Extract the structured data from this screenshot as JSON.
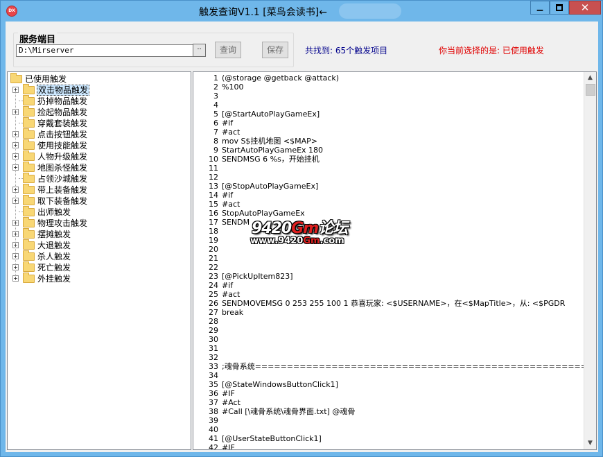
{
  "window": {
    "icon_text": "DX",
    "title": "触发查询V1.1 [菜鸟会读书]←",
    "min_glyph": "▁",
    "close_glyph": "✕"
  },
  "toolbar": {
    "group_title": "服务端目",
    "path_value": "D:\\Mirserver",
    "browse_label": "··",
    "query_label": "查询",
    "save_label": "保存",
    "found_text": "共找到: 65个触发项目",
    "selected_text": "你当前选择的是: 已使用触发"
  },
  "tree": {
    "root": "已使用触发",
    "items": [
      {
        "label": "双击物品触发",
        "expandable": true,
        "selected": true
      },
      {
        "label": "扔掉物品触发",
        "expandable": false
      },
      {
        "label": "捡起物品触发",
        "expandable": true
      },
      {
        "label": "穿戴套装触发",
        "expandable": false
      },
      {
        "label": "点击按钮触发",
        "expandable": true
      },
      {
        "label": "使用技能触发",
        "expandable": true
      },
      {
        "label": "人物升级触发",
        "expandable": true
      },
      {
        "label": "地图杀怪触发",
        "expandable": true
      },
      {
        "label": "占领沙城触发",
        "expandable": false
      },
      {
        "label": "带上装备触发",
        "expandable": true
      },
      {
        "label": "取下装备触发",
        "expandable": true
      },
      {
        "label": "出师触发",
        "expandable": false
      },
      {
        "label": "物理攻击触发",
        "expandable": true
      },
      {
        "label": "摆摊触发",
        "expandable": true
      },
      {
        "label": "大退触发",
        "expandable": true
      },
      {
        "label": "杀人触发",
        "expandable": true
      },
      {
        "label": "死亡触发",
        "expandable": true
      },
      {
        "label": "外挂触发",
        "expandable": true
      }
    ]
  },
  "editor": {
    "lines": [
      "(@storage @getback @attack)",
      "%100",
      "",
      "",
      "[@StartAutoPlayGameEx]",
      "#if",
      "#act",
      "mov S$挂机地图 <$MAP>",
      "StartAutoPlayGameEx 180",
      "SENDMSG 6 %s，开始挂机",
      "",
      "",
      "[@StopAutoPlayGameEx]",
      "#if",
      "#act",
      "StopAutoPlayGameEx",
      "SENDM",
      "",
      "",
      "",
      "",
      "",
      "[@PickUpItem823]",
      "#if",
      "#act",
      "SENDMOVEMSG 0 253 255 100 1 恭喜玩家: <$USERNAME>，在<$MapTitle>，从: <$PGDR",
      "break",
      "",
      "",
      "",
      "",
      "",
      ";魂骨系统=======================================================",
      "",
      "[@StateWindowsButtonClick1]",
      "#IF",
      "#Act",
      "#Call [\\魂骨系统\\魂骨界面.txt] @魂骨",
      "",
      "",
      "[@UserStateButtonClick1]",
      "#IF"
    ],
    "scroll_up": "▲",
    "scroll_down": "▼"
  },
  "watermark": {
    "line1_a": "9420",
    "line1_gm": "Gm",
    "line1_b": "论坛",
    "line2_a": "www.9420",
    "line2_gm": "Gm",
    "line2_b": ".com"
  }
}
